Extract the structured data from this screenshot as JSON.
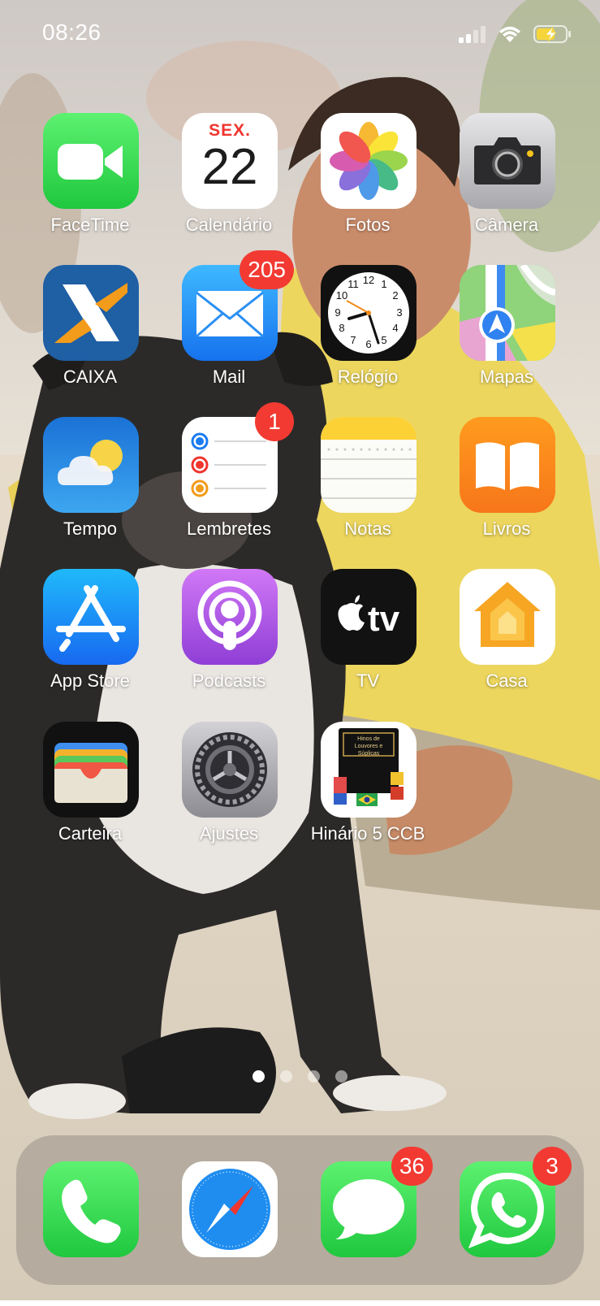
{
  "status_bar": {
    "time": "08:26"
  },
  "home": {
    "apps": [
      {
        "label": "FaceTime"
      },
      {
        "label": "Calendário",
        "day_name": "SEX.",
        "day_number": "22"
      },
      {
        "label": "Fotos"
      },
      {
        "label": "Câmera"
      },
      {
        "label": "CAIXA"
      },
      {
        "label": "Mail",
        "badge": "205"
      },
      {
        "label": "Relógio"
      },
      {
        "label": "Mapas"
      },
      {
        "label": "Tempo"
      },
      {
        "label": "Lembretes",
        "badge": "1"
      },
      {
        "label": "Notas"
      },
      {
        "label": "Livros"
      },
      {
        "label": "App Store"
      },
      {
        "label": "Podcasts"
      },
      {
        "label": "TV"
      },
      {
        "label": "Casa"
      },
      {
        "label": "Carteira"
      },
      {
        "label": "Ajustes"
      },
      {
        "label": "Hinário 5 CCB",
        "icon_text": "Hinos de Louvores e Súplicas"
      }
    ],
    "page_count": 4,
    "current_page": 1
  },
  "dock": {
    "apps": [
      {
        "name": "Telefone"
      },
      {
        "name": "Safari"
      },
      {
        "name": "Mensagens",
        "badge": "36"
      },
      {
        "name": "WhatsApp",
        "badge": "3"
      }
    ]
  }
}
